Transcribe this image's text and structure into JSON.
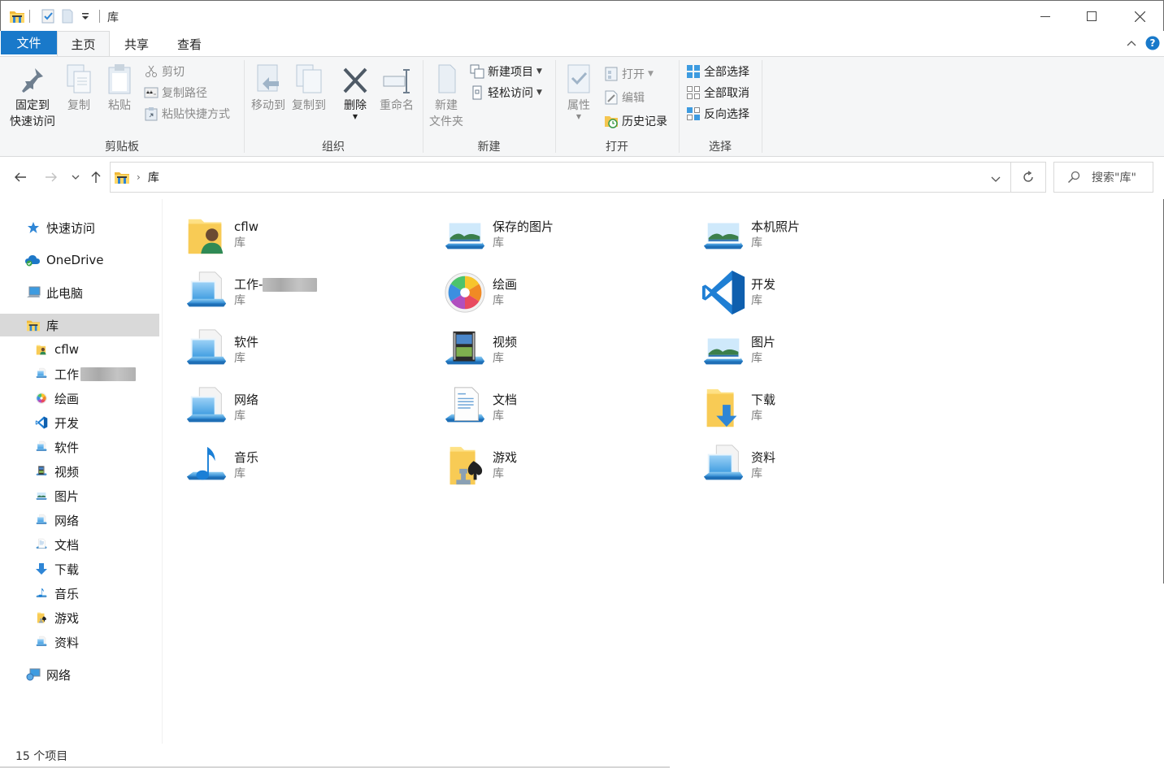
{
  "titlebar": {
    "title": "库",
    "minimize": "—",
    "maximize": "☐",
    "close": "✕"
  },
  "ribbon_tabs": {
    "file": "文件",
    "home": "主页",
    "share": "共享",
    "view": "查看",
    "help": "?"
  },
  "ribbon": {
    "clipboard": {
      "label": "剪贴板",
      "pin_line1": "固定到",
      "pin_line2": "快速访问",
      "copy": "复制",
      "paste": "粘贴",
      "cut": "剪切",
      "copy_path": "复制路径",
      "paste_shortcut": "粘贴快捷方式"
    },
    "organize": {
      "label": "组织",
      "move_to": "移动到",
      "copy_to": "复制到",
      "delete": "删除",
      "rename": "重命名"
    },
    "new": {
      "label": "新建",
      "new_folder_line1": "新建",
      "new_folder_line2": "文件夹",
      "new_item": "新建项目",
      "easy_access": "轻松访问"
    },
    "open": {
      "label": "打开",
      "properties": "属性",
      "open": "打开",
      "edit": "编辑",
      "history": "历史记录"
    },
    "select": {
      "label": "选择",
      "select_all": "全部选择",
      "select_none": "全部取消",
      "invert": "反向选择"
    }
  },
  "address": {
    "crumb": "库",
    "search_placeholder": "搜索\"库\""
  },
  "navpane": {
    "quick_access": "快速访问",
    "onedrive": "OneDrive",
    "this_pc": "此电脑",
    "libraries": "库",
    "children": [
      "cflw",
      "工作",
      "绘画",
      "开发",
      "软件",
      "视频",
      "图片",
      "网络",
      "文档",
      "下载",
      "音乐",
      "游戏",
      "资料"
    ],
    "network": "网络"
  },
  "libraries": [
    {
      "name": "cflw",
      "sub": "库",
      "icon": "user-folder-icon"
    },
    {
      "name": "保存的图片",
      "sub": "库",
      "icon": "pictures-library-icon"
    },
    {
      "name": "本机照片",
      "sub": "库",
      "icon": "pictures-library-icon"
    },
    {
      "name": "工作-",
      "sub": "库",
      "icon": "generic-library-icon"
    },
    {
      "name": "绘画",
      "sub": "库",
      "icon": "color-wheel-icon"
    },
    {
      "name": "开发",
      "sub": "库",
      "icon": "vscode-icon"
    },
    {
      "name": "软件",
      "sub": "库",
      "icon": "generic-library-icon"
    },
    {
      "name": "视频",
      "sub": "库",
      "icon": "video-library-icon"
    },
    {
      "name": "图片",
      "sub": "库",
      "icon": "pictures-library-icon"
    },
    {
      "name": "网络",
      "sub": "库",
      "icon": "generic-library-icon"
    },
    {
      "name": "文档",
      "sub": "库",
      "icon": "documents-library-icon"
    },
    {
      "name": "下载",
      "sub": "库",
      "icon": "downloads-folder-icon"
    },
    {
      "name": "音乐",
      "sub": "库",
      "icon": "music-library-icon"
    },
    {
      "name": "游戏",
      "sub": "库",
      "icon": "games-folder-icon"
    },
    {
      "name": "资料",
      "sub": "库",
      "icon": "generic-library-icon"
    }
  ],
  "status": {
    "count": "15 个项目"
  },
  "colors": {
    "file_tab": "#1979ca",
    "selection": "#d9d9d9",
    "ribbon_bg": "#f5f6f7"
  }
}
